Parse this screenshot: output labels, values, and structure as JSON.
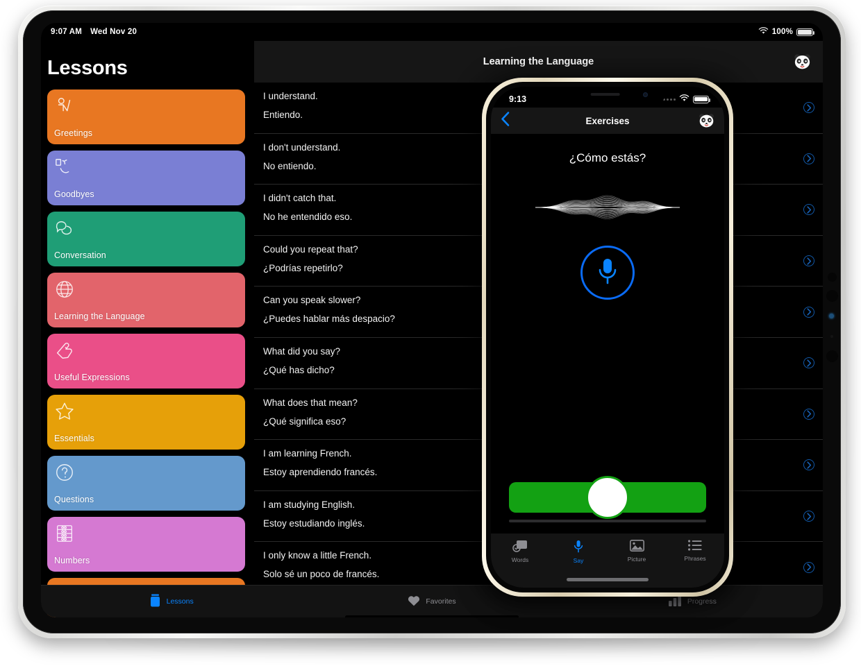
{
  "ipad": {
    "status": {
      "time": "9:07 AM",
      "date": "Wed Nov 20",
      "battery_percent": "100%"
    },
    "sidebar": {
      "title": "Lessons",
      "items": [
        {
          "label": "Greetings",
          "color": "#e87722",
          "icon": "waving-person-icon"
        },
        {
          "label": "Goodbyes",
          "color": "#7a7fd4",
          "icon": "waving-hand-door-icon"
        },
        {
          "label": "Conversation",
          "color": "#1f9e76",
          "icon": "speech-bubbles-icon"
        },
        {
          "label": "Learning the Language",
          "color": "#e2646b",
          "icon": "globe-icon"
        },
        {
          "label": "Useful Expressions",
          "color": "#ea4f88",
          "icon": "thumbs-up-icon"
        },
        {
          "label": "Essentials",
          "color": "#e6a009",
          "icon": "star-icon"
        },
        {
          "label": "Questions",
          "color": "#6499cc",
          "icon": "question-mark-icon"
        },
        {
          "label": "Numbers",
          "color": "#d579d2",
          "icon": "abacus-icon"
        },
        {
          "label": "",
          "color": "#e87722",
          "icon": "clock-icon"
        }
      ]
    },
    "detail": {
      "title": "Learning the Language",
      "avatar_icon": "panda-icon"
    },
    "phrases": [
      {
        "en": "I understand.",
        "es": "Entiendo."
      },
      {
        "en": "I don't understand.",
        "es": "No entiendo."
      },
      {
        "en": "I didn't catch that.",
        "es": "No he entendido eso."
      },
      {
        "en": "Could you repeat that?",
        "es": "¿Podrías repetirlo?"
      },
      {
        "en": "Can you speak slower?",
        "es": "¿Puedes hablar más despacio?"
      },
      {
        "en": "What did you say?",
        "es": "¿Qué has dicho?"
      },
      {
        "en": "What does that mean?",
        "es": "¿Qué significa eso?"
      },
      {
        "en": "I am learning French.",
        "es": "Estoy aprendiendo francés."
      },
      {
        "en": "I am studying English.",
        "es": "Estoy estudiando inglés."
      },
      {
        "en": "I only know a little French.",
        "es": "Solo sé un poco de francés."
      }
    ],
    "tabbar": [
      {
        "label": "Lessons",
        "icon": "book-stack-icon",
        "active": true
      },
      {
        "label": "Favorites",
        "icon": "heart-icon",
        "active": false
      },
      {
        "label": "Progress",
        "icon": "bar-chart-icon",
        "active": false
      }
    ]
  },
  "iphone": {
    "status": {
      "time": "9:13",
      "battery_percent": "100%"
    },
    "nav": {
      "back_icon": "chevron-left-icon",
      "title": "Exercises",
      "avatar_icon": "panda-icon"
    },
    "prompt": "¿Cómo estás?",
    "mic_icon": "microphone-icon",
    "success_icon": "checkmark-icon",
    "tabbar": [
      {
        "label": "Words",
        "icon": "flashcards-icon",
        "active": false
      },
      {
        "label": "Say",
        "icon": "microphone-icon",
        "active": true
      },
      {
        "label": "Picture",
        "icon": "photo-icon",
        "active": false
      },
      {
        "label": "Phrases",
        "icon": "list-icon",
        "active": false
      }
    ]
  },
  "colors": {
    "accent_blue": "#0a84ff",
    "success_green": "#13a113",
    "chevron_blue": "#1158a8"
  }
}
